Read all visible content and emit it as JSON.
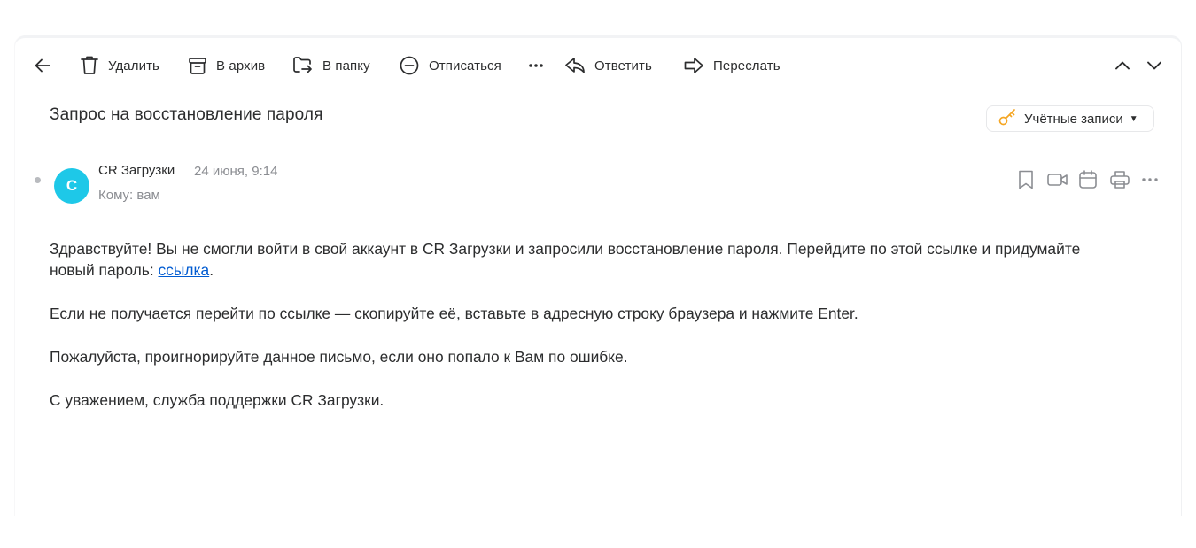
{
  "toolbar": {
    "back_icon": "arrow-left-icon",
    "delete_label": "Удалить",
    "archive_label": "В архив",
    "move_label": "В папку",
    "unsubscribe_label": "Отписаться",
    "reply_label": "Ответить",
    "forward_label": "Переслать"
  },
  "message": {
    "subject": "Запрос на восстановление пароля",
    "folder_label": "Учётные записи",
    "sender_name": "CR Загрузки",
    "avatar_letter": "C",
    "date": "24 июня, 9:14",
    "to_line": "Кому: вам",
    "body": {
      "p1_text": "Здравствуйте! Вы не смогли войти в свой аккаунт в CR Загрузки и запросили восстановление пароля. Перейдите по этой ссылке и придумайте новый пароль: ",
      "p1_link": "ссылка",
      "p1_end": ".",
      "p2": "Если не получается перейти по ссылке — скопируйте её, вставьте в адресную строку браузера и нажмите Enter.",
      "p3": "Пожалуйста, проигнорируйте данное письмо, если оно попало к Вам по ошибке.",
      "p4": "С уважением, служба поддержки CR Загрузки."
    }
  },
  "colors": {
    "avatar_bg": "#1ec8e8",
    "link": "#005bd1",
    "key_icon": "#f5a623",
    "muted_text": "#8b8d92"
  }
}
